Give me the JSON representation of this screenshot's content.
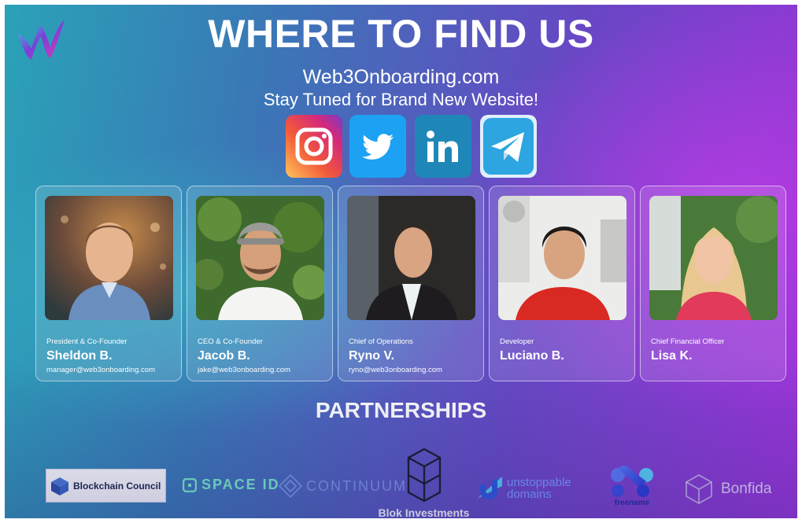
{
  "header": {
    "title": "WHERE TO FIND US",
    "website": "Web3Onboarding.com",
    "tagline": "Stay Tuned for Brand New Website!"
  },
  "brand": {
    "logo_icon": "w3o-logo-icon",
    "colors": {
      "pink": "#e23ab8",
      "cyan": "#3fd0e8",
      "purple": "#7a3fd8"
    }
  },
  "social": [
    {
      "name": "instagram",
      "icon": "instagram-icon"
    },
    {
      "name": "twitter",
      "icon": "twitter-icon"
    },
    {
      "name": "linkedin",
      "icon": "linkedin-icon"
    },
    {
      "name": "telegram",
      "icon": "telegram-icon"
    }
  ],
  "team": [
    {
      "role": "President & Co-Founder",
      "name": "Sheldon B.",
      "email": "manager@web3onboarding.com"
    },
    {
      "role": "CEO & Co-Founder",
      "name": "Jacob B.",
      "email": "jake@web3onboarding.com"
    },
    {
      "role": "Chief of Operations",
      "name": "Ryno V.",
      "email": "ryno@web3onboarding.com"
    },
    {
      "role": "Developer",
      "name": "Luciano B.",
      "email": ""
    },
    {
      "role": "Chief Financial Officer",
      "name": "Lisa K.",
      "email": ""
    }
  ],
  "partnerships": {
    "title": "PARTNERSHIPS",
    "partners": [
      {
        "name": "Blockchain Council",
        "icon": "blockchain-council-cube-icon"
      },
      {
        "name": "SPACE ID",
        "icon": "space-id-icon"
      },
      {
        "name": "CONTINUUM",
        "icon": "continuum-icon"
      },
      {
        "name": "Blok Investments",
        "icon": "blok-cube-icon"
      },
      {
        "name": "unstoppable domains",
        "line1": "unstoppable",
        "line2": "domains",
        "icon": "unstoppable-domains-icon"
      },
      {
        "name": "freename",
        "icon": "freename-icon"
      },
      {
        "name": "Bonfida",
        "icon": "bonfida-icon"
      }
    ]
  }
}
